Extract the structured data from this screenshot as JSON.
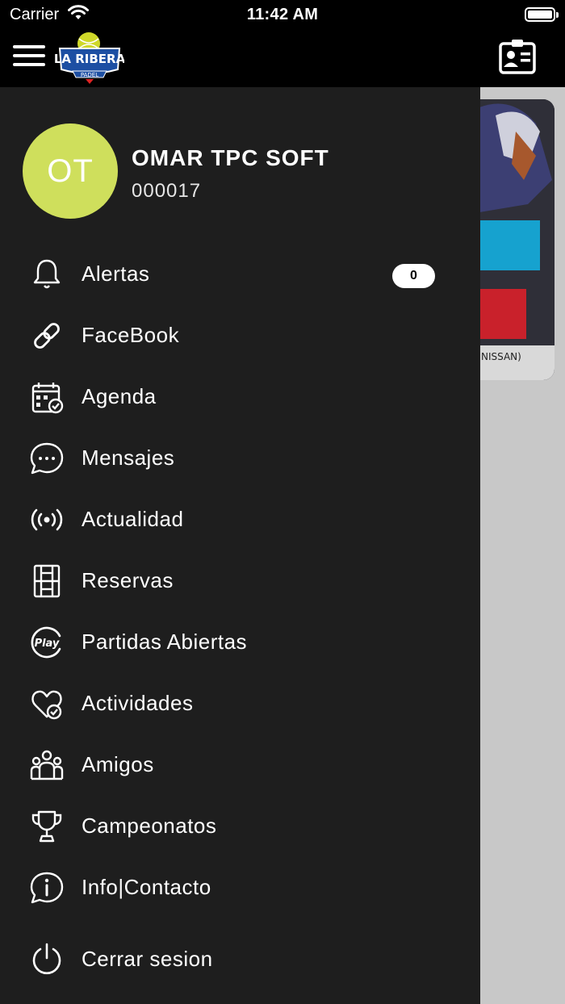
{
  "status_bar": {
    "carrier": "Carrier",
    "time": "11:42 AM"
  },
  "header": {
    "logo_text_top": "LA RIBERA",
    "logo_text_bottom": "PADEL"
  },
  "user": {
    "initials": "OT",
    "name": "OMAR TPC SOFT",
    "code": "000017"
  },
  "menu": {
    "items": [
      {
        "label": "Alertas",
        "icon": "bell-icon",
        "badge": "0"
      },
      {
        "label": "FaceBook",
        "icon": "link-icon"
      },
      {
        "label": "Agenda",
        "icon": "calendar-check-icon"
      },
      {
        "label": "Mensajes",
        "icon": "chat-bubble-icon"
      },
      {
        "label": "Actualidad",
        "icon": "broadcast-icon"
      },
      {
        "label": "Reservas",
        "icon": "court-icon"
      },
      {
        "label": "Partidas Abiertas",
        "icon": "play-icon"
      },
      {
        "label": "Actividades",
        "icon": "heart-check-icon"
      },
      {
        "label": "Amigos",
        "icon": "group-icon"
      },
      {
        "label": "Campeonatos",
        "icon": "trophy-icon"
      },
      {
        "label": "Info|Contacto",
        "icon": "info-bubble-icon"
      },
      {
        "label": "Cerrar sesion",
        "icon": "power-icon"
      }
    ]
  },
  "colors": {
    "avatar_bg": "#cfdf5c",
    "drawer_bg": "#1e1e1e",
    "header_bg": "#000000",
    "scrim": "#c8c8c8"
  }
}
